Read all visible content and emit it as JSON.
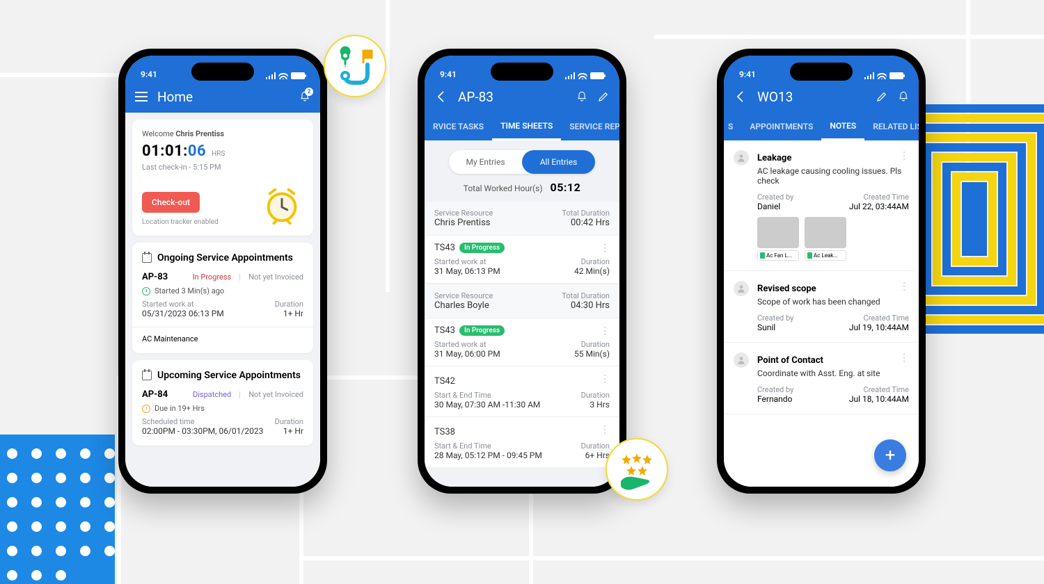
{
  "status_time": "9:41",
  "phone1": {
    "title": "Home",
    "notif_badge": "2",
    "welcome_prefix": "Welcome ",
    "user_name": "Chris Prentiss",
    "timer_hm": "01:01:",
    "timer_s": "06",
    "timer_unit": "HRS",
    "last_checkin": "Last check-in - 5:15 PM",
    "checkout_btn": "Check-out",
    "tracker_text": "Location tracker enabled",
    "ongoing_title": "Ongoing Service Appointments",
    "ongoing": {
      "id": "AP-83",
      "status": "In Progress",
      "invoice": "Not yet Invoiced",
      "started_ago": "Started 3 Min(s) ago",
      "started_label": "Started work at",
      "started_value": "05/31/2023 06:13 PM",
      "duration_label": "Duration",
      "duration_value": "1+ Hr",
      "job": "AC Maintenance"
    },
    "upcoming_title": "Upcoming Service Appointments",
    "upcoming": {
      "id": "AP-84",
      "status": "Dispatched",
      "invoice": "Not yet Invoiced",
      "due_in": "Due in 19+ Hrs",
      "scheduled_label": "Scheduled time",
      "scheduled_value": "02:00PM - 03:30PM, 06/01/2023",
      "duration_label": "Duration",
      "duration_value": "1+ Hr"
    }
  },
  "phone2": {
    "title": "AP-83",
    "tabs": {
      "t1": "RVICE TASKS",
      "t2": "TIME SHEETS",
      "t3": "SERVICE REP"
    },
    "seg": {
      "my": "My Entries",
      "all": "All Entries"
    },
    "twh_label": "Total Worked Hour(s)",
    "twh_value": "05:12",
    "groups": [
      {
        "res_label": "Service Resource",
        "res_name": "Chris Prentiss",
        "dur_label": "Total Duration",
        "dur_value": "00:42 Hrs",
        "items": [
          {
            "id": "TS43",
            "status": "In Progress",
            "l1_label": "Started work at",
            "l1_value": "31 May, 06:13 PM",
            "r1_label": "Duration",
            "r1_value": "42 Min(s)"
          }
        ]
      },
      {
        "res_label": "Service Resource",
        "res_name": "Charles Boyle",
        "dur_label": "Total Duration",
        "dur_value": "04:30 Hrs",
        "items": [
          {
            "id": "TS43",
            "status": "In Progress",
            "l1_label": "Started work at",
            "l1_value": "31 May, 06:00 PM",
            "r1_label": "Duration",
            "r1_value": "55 Min(s)"
          },
          {
            "id": "TS42",
            "status": "",
            "l1_label": "Start & End Time",
            "l1_value": "30 May, 07:30 AM -11:30 AM",
            "r1_label": "Duration",
            "r1_value": "3 Hrs"
          },
          {
            "id": "TS38",
            "status": "",
            "l1_label": "Start & End Time",
            "l1_value": "28 May, 05:12 PM - 09:45 PM",
            "r1_label": "Duration",
            "r1_value": "6+ Hrs"
          }
        ]
      }
    ]
  },
  "phone3": {
    "title": "WO13",
    "tabs": {
      "t0": "S",
      "t1": "APPOINTMENTS",
      "t2": "NOTES",
      "t3": "RELATED LIS"
    },
    "notes": [
      {
        "title": "Leakage",
        "body": "AC leakage causing cooling issues. Pls check",
        "by_label": "Created by",
        "by": "Daniel",
        "time_label": "Created Time",
        "time": "Jul 22, 03:44AM",
        "attachments": [
          {
            "name": "Ac Fan L..."
          },
          {
            "name": "Ac Leak..."
          }
        ]
      },
      {
        "title": "Revised scope",
        "body": "Scope of work has been changed",
        "by_label": "Created by",
        "by": "Sunil",
        "time_label": "Created Time",
        "time": "Jul 19, 10:44AM"
      },
      {
        "title": "Point of Contact",
        "body": "Coordinate with Asst. Eng. at site",
        "by_label": "Created by",
        "by": "Fernando",
        "time_label": "Created Time",
        "time": "Jul 18, 10:44AM"
      }
    ]
  }
}
